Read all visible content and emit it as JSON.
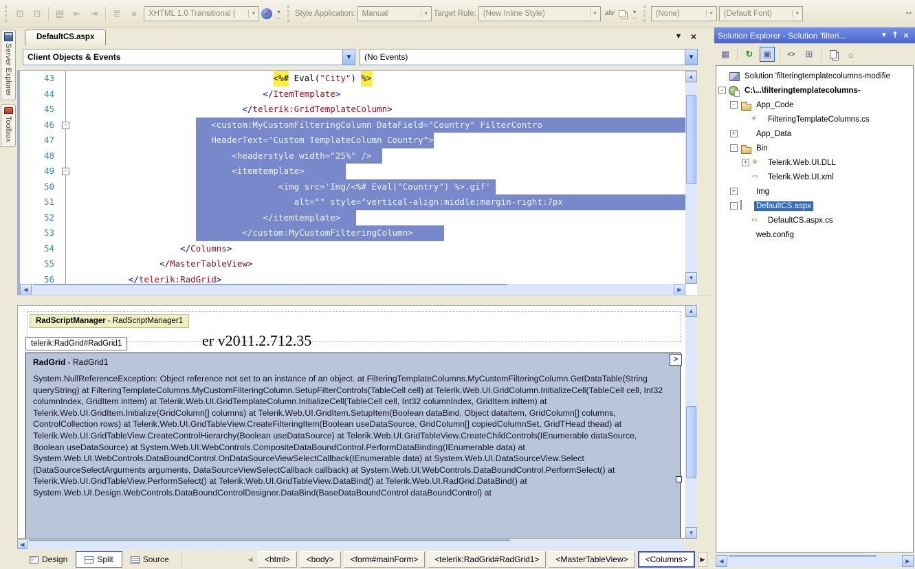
{
  "colors": {
    "chrome_beige": "#ece9d8",
    "titlebar_blue": "#4a63cc",
    "tree_selection": "#316ac5",
    "code_selection": "#7789cb",
    "error_panel_bg": "#b9c5db",
    "token_highlight": "#ffef3d"
  },
  "toolbar": {
    "doctype_value": "XHTML 1.0 Transitional ( ",
    "style_application_label": "Style Application:",
    "style_application_value": "Manual",
    "target_rule_label": "Target Rule:",
    "target_rule_value": "(New Inline Style)",
    "css_class_value": "(None)",
    "font_value": "(Default Font)",
    "apply_styles_glyph": "ab",
    "overflow_glyph": "▾"
  },
  "left_tabs": [
    {
      "label": "Server Explorer",
      "icon": "server-explorer-icon"
    },
    {
      "label": "Toolbox",
      "icon": "toolbox-icon"
    }
  ],
  "editor": {
    "tab_title": "DefaultCS.aspx",
    "object_dropdown": "Client Objects & Events",
    "event_dropdown": "(No Events)",
    "code_lines": [
      {
        "num": 43,
        "indent": 39,
        "segments": [
          {
            "t": "<%#",
            "s": "hl"
          },
          {
            "t": " Eval(",
            "s": "p"
          },
          {
            "t": "\"City\"",
            "s": "str"
          },
          {
            "t": ") ",
            "s": "p"
          },
          {
            "t": "%>",
            "s": "hl"
          }
        ]
      },
      {
        "num": 44,
        "indent": 37,
        "segments": [
          {
            "t": "</",
            "s": "delim"
          },
          {
            "t": "ItemTemplate",
            "s": "tag"
          },
          {
            "t": ">",
            "s": "delim"
          }
        ]
      },
      {
        "num": 45,
        "indent": 33,
        "segments": [
          {
            "t": "</",
            "s": "delim"
          },
          {
            "t": "telerik:GridTemplateColumn",
            "s": "tag"
          },
          {
            "t": ">",
            "s": "delim"
          }
        ]
      },
      {
        "num": 46,
        "fold": "-",
        "selected": true,
        "sel_start": 24,
        "indent": 27,
        "clip": true,
        "trail": 0,
        "text": "<custom:MyCustomFilteringColumn DataField=\"Country\" FilterContro"
      },
      {
        "num": 47,
        "selected": true,
        "sel_start": 24,
        "indent": 27,
        "clip": false,
        "trail": 0,
        "text": "HeaderText=\"Custom TemplateColumn Country\">"
      },
      {
        "num": 48,
        "selected": true,
        "sel_start": 24,
        "indent": 31,
        "clip": false,
        "trail": 2,
        "text": "<headerstyle width=\"25%\" />"
      },
      {
        "num": 49,
        "fold": "-",
        "selected": true,
        "sel_start": 24,
        "indent": 31,
        "clip": false,
        "trail": 8,
        "text": "<itemtemplate>"
      },
      {
        "num": 50,
        "selected": true,
        "sel_start": 24,
        "indent": 40,
        "clip": false,
        "trail": 1,
        "text": "<img src='Img/<%# Eval(\"Country\") %>.gif'"
      },
      {
        "num": 51,
        "selected": true,
        "sel_start": 24,
        "indent": 43,
        "clip": true,
        "trail": 0,
        "text": "alt=\"\" style=\"vertical-align:middle;margin-right:7px"
      },
      {
        "num": 52,
        "selected": true,
        "sel_start": 24,
        "indent": 37,
        "clip": false,
        "trail": 3,
        "text": "</itemtemplate>"
      },
      {
        "num": 53,
        "selected": true,
        "sel_start": 24,
        "indent": 33,
        "clip": false,
        "trail": 6,
        "text": "</custom:MyCustomFilteringColumn>"
      },
      {
        "num": 54,
        "indent": 21,
        "segments": [
          {
            "t": "</",
            "s": "delim"
          },
          {
            "t": "Columns",
            "s": "tag"
          },
          {
            "t": ">",
            "s": "delim"
          }
        ]
      },
      {
        "num": 55,
        "indent": 17,
        "segments": [
          {
            "t": "</",
            "s": "delim"
          },
          {
            "t": "MasterTableView",
            "s": "tag"
          },
          {
            "t": ">",
            "s": "delim"
          }
        ]
      },
      {
        "num": 56,
        "indent": 11,
        "segments": [
          {
            "t": "</",
            "s": "delim"
          },
          {
            "t": "telerik:RadGrid",
            "s": "tag"
          },
          {
            "t": ">",
            "s": "delim"
          }
        ]
      }
    ]
  },
  "design": {
    "scriptmanager_bold": "RadScriptManager",
    "scriptmanager_rest": " - RadScriptManager1",
    "tooltip": "telerik:RadGrid#RadGrid1",
    "version_fragment": "er v2011.2.712.35",
    "grid_header_bold": "RadGrid",
    "grid_header_rest": " - RadGrid1",
    "smart_tag_glyph": ">",
    "stack_trace": "System.NullReferenceException: Object reference not set to an instance of an object. at FilteringTemplateColumns.MyCustomFilteringColumn.GetDataTable(String queryString) at FilteringTemplateColumns.MyCustomFilteringColumn.SetupFilterControls(TableCell cell) at Telerik.Web.UI.GridColumn.InitializeCell(TableCell cell, Int32 columnIndex, GridItem inItem) at Telerik.Web.UI.GridTemplateColumn.InitializeCell(TableCell cell, Int32 columnIndex, GridItem inItem) at Telerik.Web.UI.GridItem.Initialize(GridColumn[] columns) at Telerik.Web.UI.GridItem.SetupItem(Boolean dataBind, Object dataItem, GridColumn[] columns, ControlCollection rows) at Telerik.Web.UI.GridTableView.CreateFilteringItem(Boolean useDataSource, GridColumn[] copiedColumnSet, GridTHead thead) at Telerik.Web.UI.GridTableView.CreateControlHierarchy(Boolean useDataSource) at Telerik.Web.UI.GridTableView.CreateChildControls(IEnumerable dataSource, Boolean useDataSource) at System.Web.UI.WebControls.CompositeDataBoundControl.PerformDataBinding(IEnumerable data) at System.Web.UI.WebControls.DataBoundControl.OnDataSourceViewSelectCallback(IEnumerable data) at System.Web.UI.DataSourceView.Select (DataSourceSelectArguments arguments, DataSourceViewSelectCallback callback) at System.Web.UI.WebControls.DataBoundControl.PerformSelect() at Telerik.Web.UI.GridTableView.PerformSelect() at Telerik.Web.UI.GridTableView.DataBind() at Telerik.Web.UI.RadGrid.DataBind() at System.Web.UI.Design.WebControls.DataBoundControlDesigner.DataBind(BaseDataBoundControl dataBoundControl) at"
  },
  "bottom_bar": {
    "views": [
      {
        "label": "Design",
        "icon": "design-view-icon",
        "active": false
      },
      {
        "label": "Split",
        "icon": "split-view-icon",
        "active": true
      },
      {
        "label": "Source",
        "icon": "source-view-icon",
        "active": false
      }
    ],
    "breadcrumbs": [
      {
        "label": "<html>",
        "active": false
      },
      {
        "label": "<body>",
        "active": false
      },
      {
        "label": "<form#mainForm>",
        "active": false
      },
      {
        "label": "<telerik:RadGrid#RadGrid1>",
        "active": false
      },
      {
        "label": "<MasterTableView>",
        "active": false
      },
      {
        "label": "<Columns>",
        "active": true
      }
    ]
  },
  "solution_explorer": {
    "title": "Solution Explorer - Solution 'filteri...",
    "toolbar_icons": [
      "properties-icon",
      "refresh-icon",
      "nest-related-files-icon",
      "view-code-icon",
      "view-designer-icon",
      "copy-website-icon",
      "aspnet-configuration-icon"
    ],
    "tree": [
      {
        "label": "Solution 'filteringtemplatecolumns-modifie",
        "icon": "i-sol",
        "level": 0,
        "expand": ""
      },
      {
        "label": "C:\\...\\filteringtemplatecolumns-",
        "icon": "i-web",
        "level": 0,
        "expand": "-",
        "bold": true
      },
      {
        "label": "App_Code",
        "icon": "i-folder",
        "level": 1,
        "expand": "-"
      },
      {
        "label": "FilteringTemplateColumns.cs",
        "icon": "i-cs",
        "level": 2,
        "expand": ""
      },
      {
        "label": "App_Data",
        "icon": "i-data",
        "level": 1,
        "expand": "+"
      },
      {
        "label": "Bin",
        "icon": "i-folder",
        "level": 1,
        "expand": "-"
      },
      {
        "label": "Telerik.Web.UI.DLL",
        "icon": "i-dll",
        "level": 2,
        "expand": "+"
      },
      {
        "label": "Telerik.Web.UI.xml",
        "icon": "i-xml",
        "level": 2,
        "expand": ""
      },
      {
        "label": "Img",
        "icon": "i-img",
        "level": 1,
        "expand": "+"
      },
      {
        "label": "DefaultCS.aspx",
        "icon": "i-aspx",
        "level": 1,
        "expand": "-",
        "selected": true
      },
      {
        "label": "DefaultCS.aspx.cs",
        "icon": "i-aspxcs",
        "level": 2,
        "expand": ""
      },
      {
        "label": "web.config",
        "icon": "i-config",
        "level": 1,
        "expand": ""
      }
    ]
  }
}
